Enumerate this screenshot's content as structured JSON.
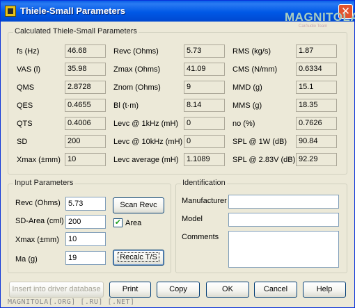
{
  "window": {
    "title": "Thiele-Small Parameters",
    "close_glyph": "✕"
  },
  "logo": {
    "main": "MAGNITOLA",
    "sub": "CarAudio Team"
  },
  "calculated": {
    "title": "Calculated Thiele-Small Parameters",
    "rows": [
      {
        "l1": "fs (Hz)",
        "v1": "46.68",
        "l2": "Revc (Ohms)",
        "v2": "5.73",
        "l3": "RMS (kg/s)",
        "v3": "1.87"
      },
      {
        "l1": "VAS (l)",
        "v1": "35.98",
        "l2": "Zmax (Ohms)",
        "v2": "41.09",
        "l3": "CMS (N/mm)",
        "v3": "0.6334"
      },
      {
        "l1": "QMS",
        "v1": "2.8728",
        "l2": "Znom (Ohms)",
        "v2": "9",
        "l3": "MMD (g)",
        "v3": "15.1"
      },
      {
        "l1": "QES",
        "v1": "0.4655",
        "l2": "Bl (t·m)",
        "v2": "8.14",
        "l3": "MMS (g)",
        "v3": "18.35"
      },
      {
        "l1": "QTS",
        "v1": "0.4006",
        "l2": "Levc @ 1kHz (mH)",
        "v2": "0",
        "l3": "no (%)",
        "v3": "0.7626"
      },
      {
        "l1": "SD",
        "v1": "200",
        "l2": "Levc @ 10kHz (mH)",
        "v2": "0",
        "l3": "SPL @ 1W (dB)",
        "v3": "90.84"
      },
      {
        "l1": "Xmax (±mm)",
        "v1": "10",
        "l2": "Levc average (mH)",
        "v2": "1.1089",
        "l3": "SPL @ 2.83V (dB)",
        "v3": "92.29"
      }
    ]
  },
  "input": {
    "title": "Input Parameters",
    "revc_label": "Revc (Ohms)",
    "revc_value": "5.73",
    "sd_label": "SD-Area (cml)",
    "sd_value": "200",
    "xmax_label": "Xmax (±mm)",
    "xmax_value": "10",
    "ma_label": "Ma (g)",
    "ma_value": "19",
    "scan_button": "Scan Revc",
    "area_label": "Area",
    "area_checked": "✔",
    "recalc_button": "Recalc T/S"
  },
  "identification": {
    "title": "Identification",
    "manufacturer_label": "Manufacturer",
    "manufacturer_value": "",
    "model_label": "Model",
    "model_value": "",
    "comments_label": "Comments",
    "comments_value": ""
  },
  "buttons": {
    "insert": "Insert into driver database",
    "print": "Print",
    "copy": "Copy",
    "ok": "OK",
    "cancel": "Cancel",
    "help": "Help"
  },
  "status": {
    "text": "MAGNITOLA[.ORG] [.RU] [.NET]"
  }
}
